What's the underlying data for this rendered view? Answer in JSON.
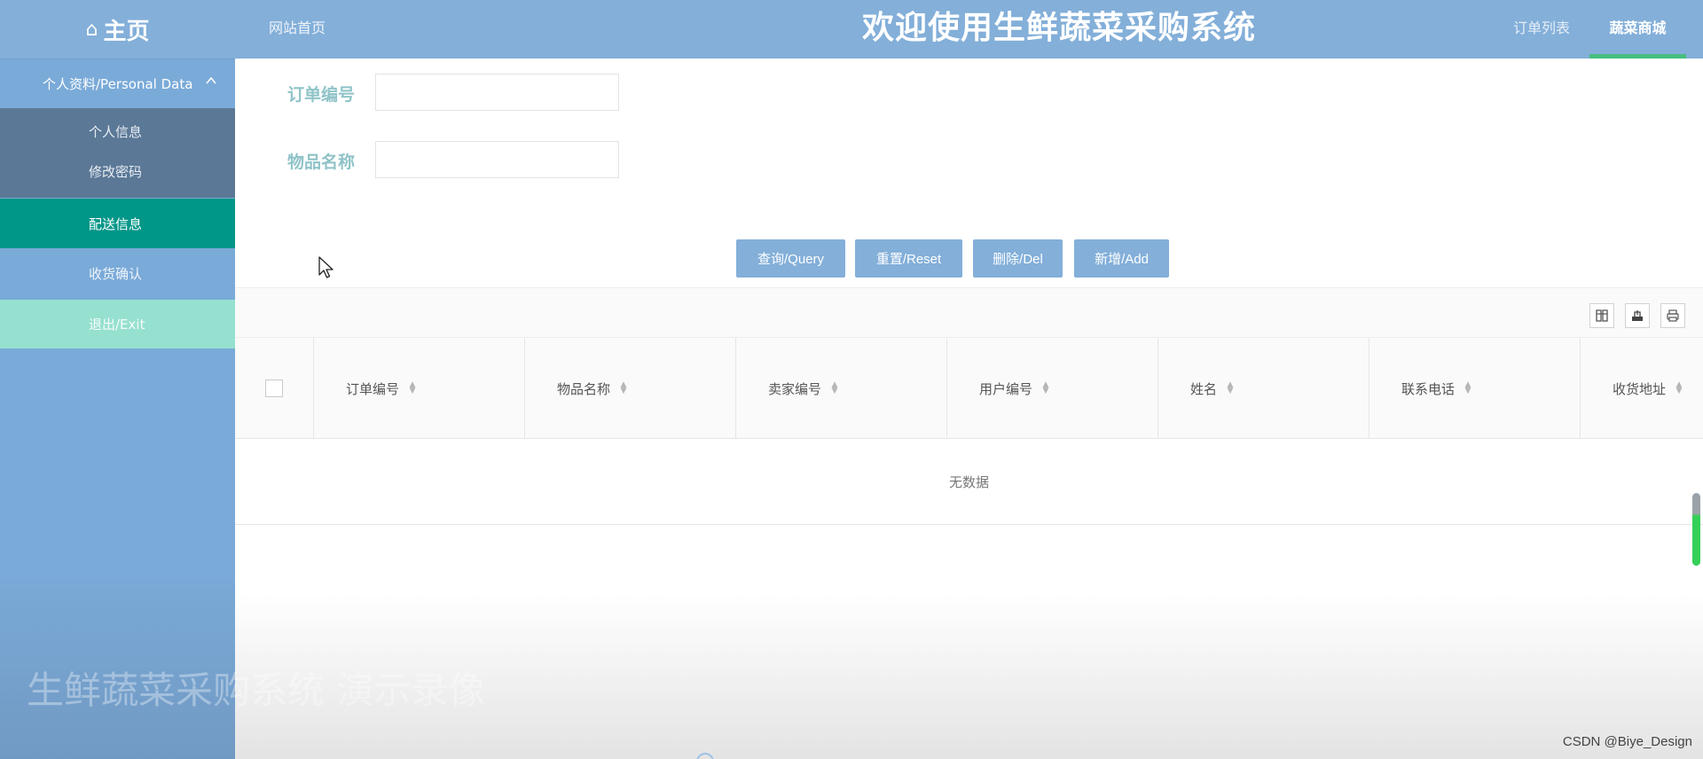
{
  "header": {
    "home_label": "主页",
    "home_icon": "home-icon",
    "site_home": "网站首页",
    "title": "欢迎使用生鲜蔬菜采购系统",
    "nav_orders": "订单列表",
    "nav_shop": "蔬菜商城",
    "bar_color": "#83afd9",
    "active_indicator_color": "#46be7f"
  },
  "sidebar": {
    "group_label": "个人资料/Personal Data",
    "group_expanded": true,
    "sub_items": [
      "个人信息",
      "修改密码"
    ],
    "delivery": "配送信息",
    "receipt": "收货确认",
    "exit": "退出/Exit",
    "active_color": "#009688"
  },
  "search": {
    "order_no_label": "订单编号",
    "order_no_value": "",
    "item_name_label": "物品名称",
    "item_name_value": ""
  },
  "buttons": {
    "query": "查询/Query",
    "reset": "重置/Reset",
    "delete": "删除/Del",
    "add": "新增/Add"
  },
  "toolbar": {
    "icons": [
      "columns-icon",
      "export-icon",
      "print-icon"
    ]
  },
  "table": {
    "columns": [
      "订单编号",
      "物品名称",
      "卖家编号",
      "用户编号",
      "姓名",
      "联系电话",
      "收货地址"
    ],
    "rows": [],
    "empty_text": "无数据"
  },
  "watermark": "生鲜蔬菜采购系统 演示录像",
  "credit": "CSDN @Biye_Design"
}
